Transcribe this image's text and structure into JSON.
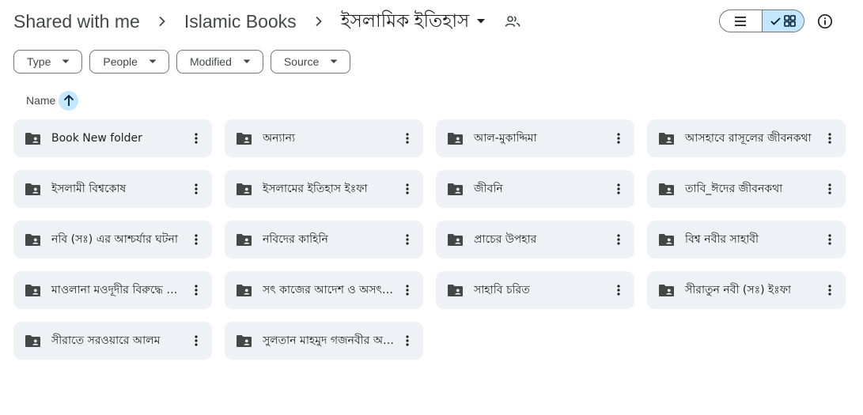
{
  "breadcrumb": {
    "items": [
      "Shared with me",
      "Islamic Books"
    ],
    "current": "ইসলামিক ইতিহাস"
  },
  "icons": {
    "separator": "chevron-right-icon",
    "dropdown": "arrow-drop-down-icon",
    "shared": "people-icon",
    "list_view": "list-view-icon",
    "grid_view": "grid-view-icon",
    "check": "check-icon",
    "info": "info-icon",
    "folder": "shared-folder-icon",
    "more": "more-vert-icon",
    "sort": "arrow-upward-icon"
  },
  "view": {
    "selected": "grid"
  },
  "filters": [
    "Type",
    "People",
    "Modified",
    "Source"
  ],
  "sort": {
    "label": "Name",
    "direction": "ascending"
  },
  "folders": [
    "Book New folder",
    "অন্যান্য",
    "আল-মুকাদ্দিমা",
    "আসহাবে রাসূলের জীবনকথা",
    "ইসলামী বিশ্বকোষ",
    "ইসলামের ইতিহাস ইঃফা",
    "জীবনি",
    "তাবি_ঈদের জীবনকথা",
    "নবি (সঃ) এর আশ্চর্যার ঘটনা",
    "নবিদের কাহিনি",
    "প্রাচের উপহার",
    "বিশ্ব নবীর সাহাবী",
    "মাওলানা মওদূদীর বিরুদ্ধে অপপ্রচার",
    "সৎ কাজের আদেশ ও অসৎ কাজের নিষেধ",
    "সাহাবি চরিত",
    "সীরাতুন নবী (সঃ) ইঃফা",
    "সীরাতে সরওয়ারে আলম",
    "সুলতান মাহমুদ গজনবীর অভিযান"
  ],
  "colors": {
    "accent": "#c2e7ff",
    "card_bg": "#eef1f6",
    "icon": "#444746",
    "text": "#1f1f1f"
  }
}
